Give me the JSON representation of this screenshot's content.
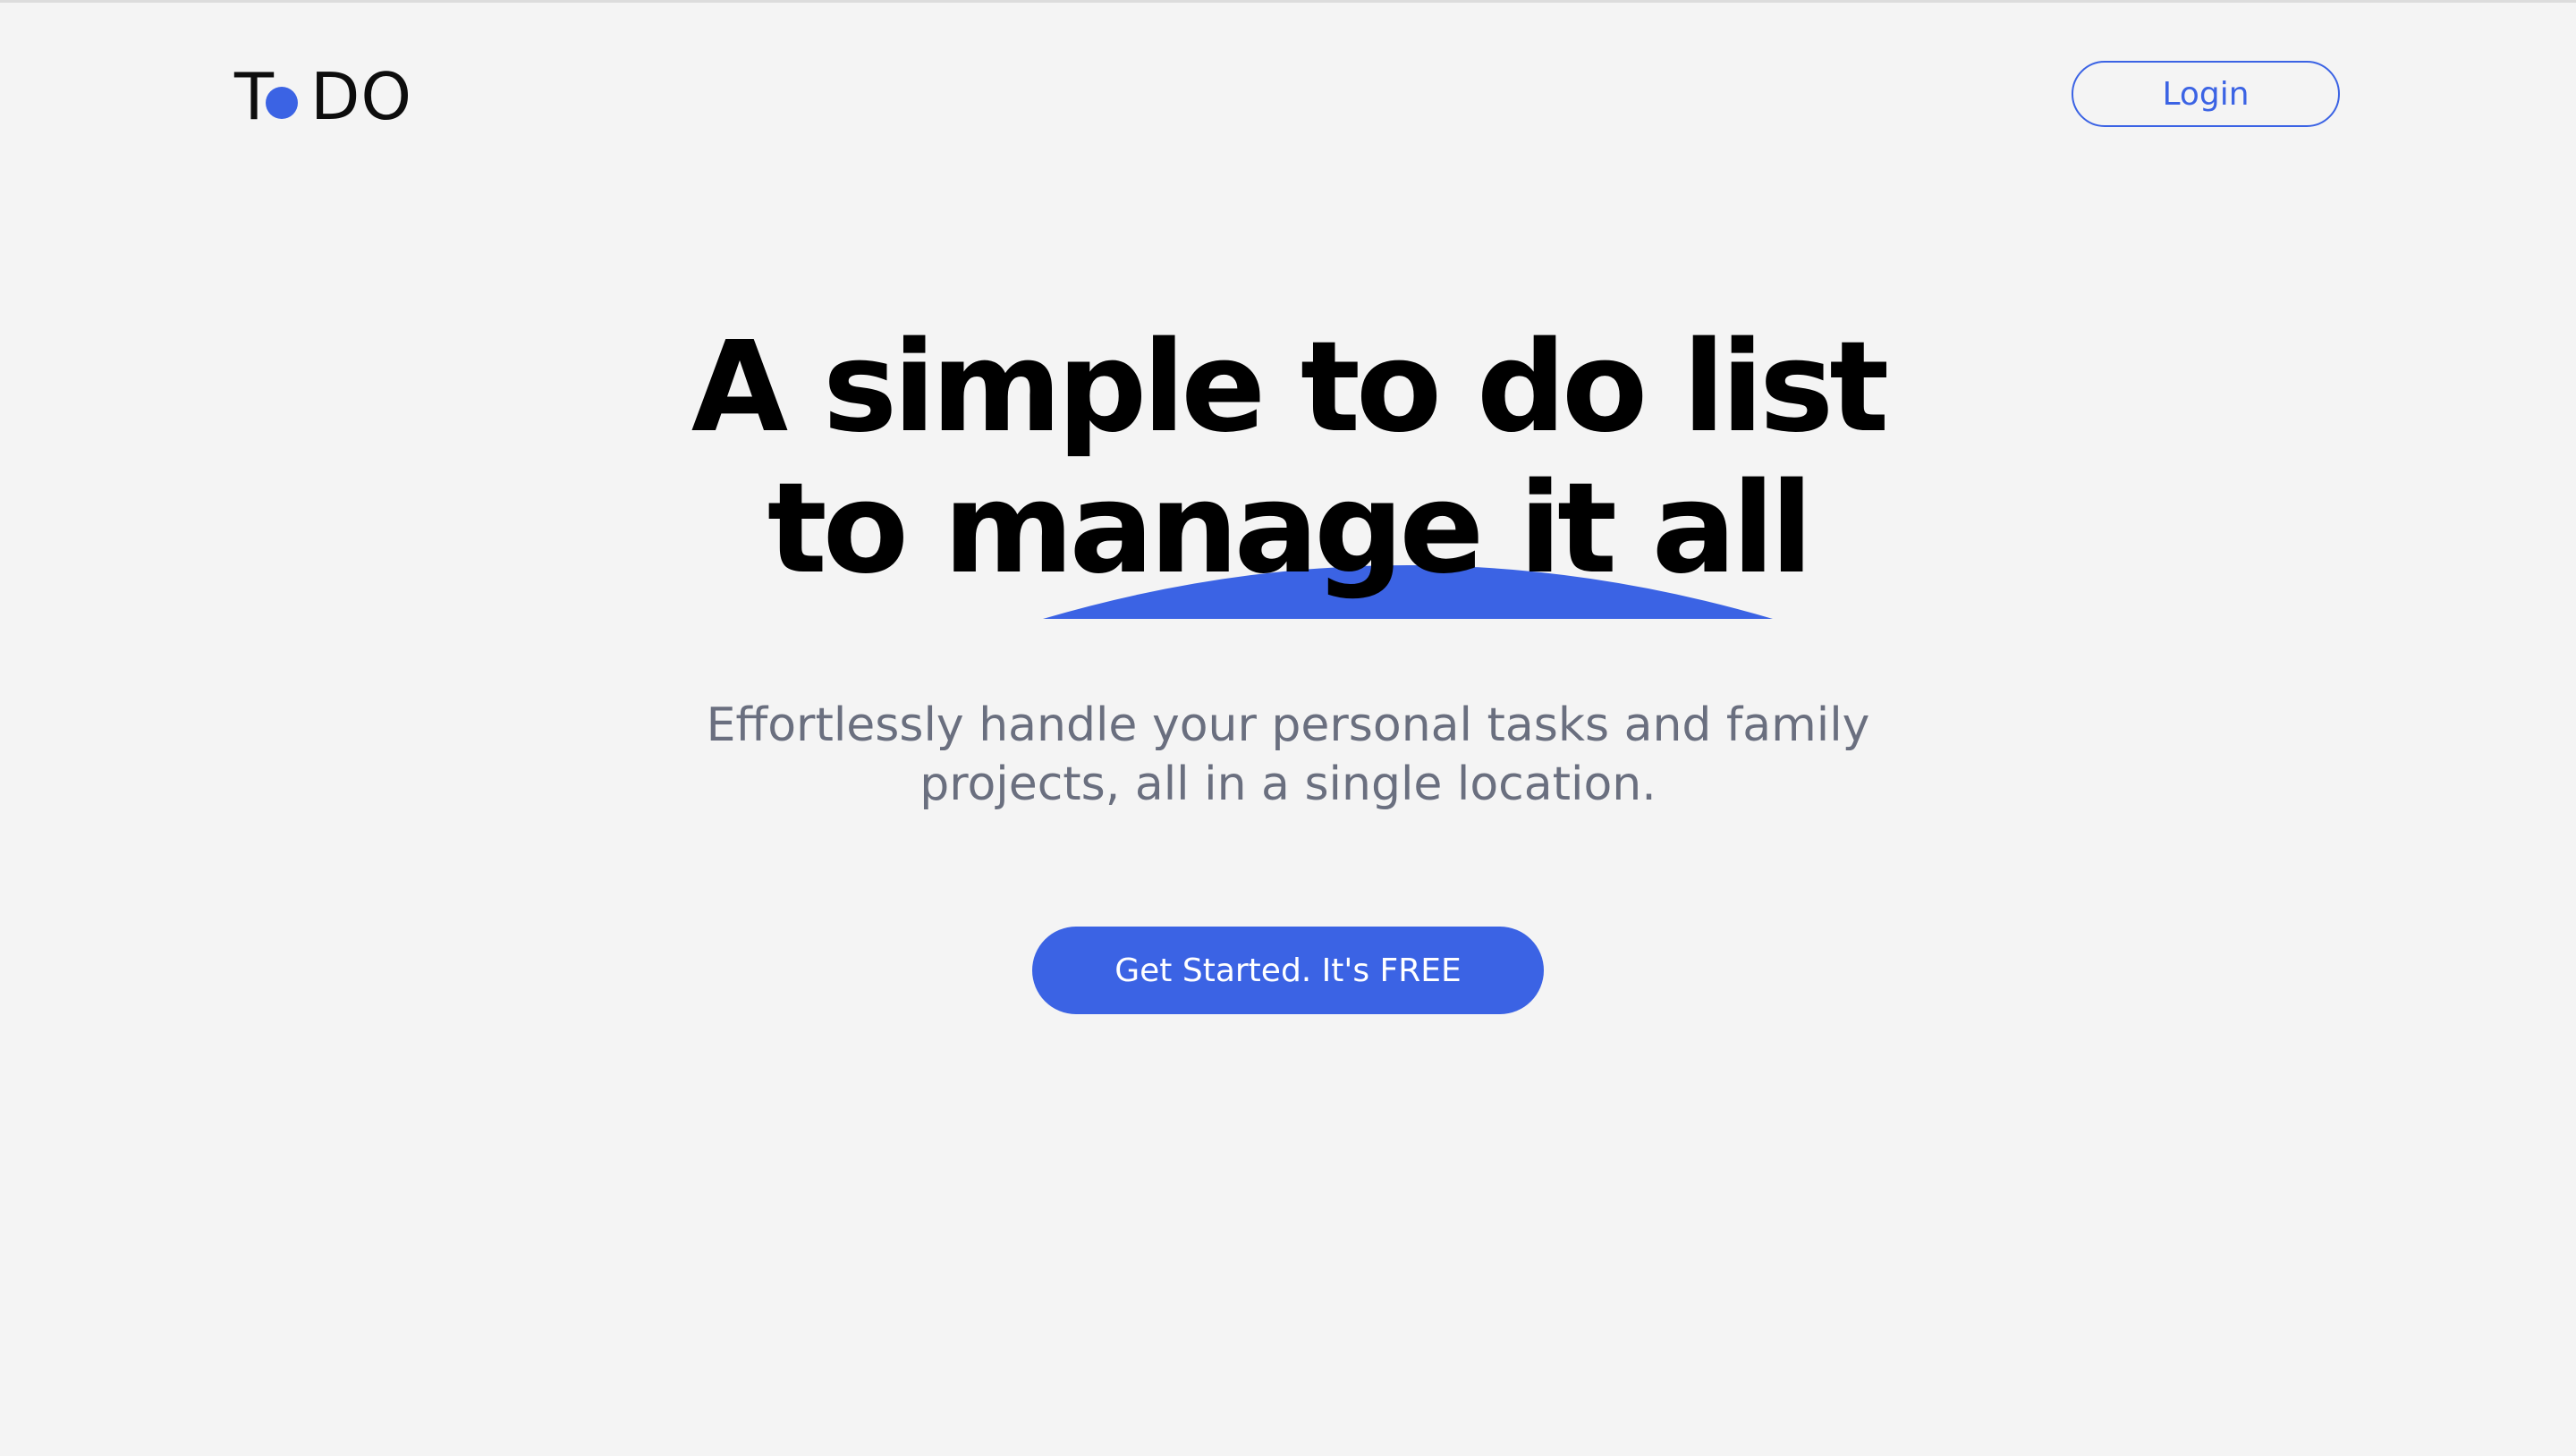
{
  "header": {
    "logo": {
      "left": "T",
      "right": "DO"
    },
    "login_label": "Login"
  },
  "hero": {
    "headline_line1": "A simple to do list",
    "headline_line2": "to manage it all",
    "subtitle_line1": "Effortlessly handle your personal tasks and family",
    "subtitle_line2": "projects, all in a single location.",
    "cta_label": "Get Started. It's FREE"
  },
  "colors": {
    "accent": "#3b63e4",
    "background": "#f4f4f4",
    "headline": "#000000",
    "subtitle": "#6a6f7f"
  },
  "icons": {
    "logo_dot": "blue-dot-icon",
    "headline_accent": "blue-swoosh-decoration"
  }
}
